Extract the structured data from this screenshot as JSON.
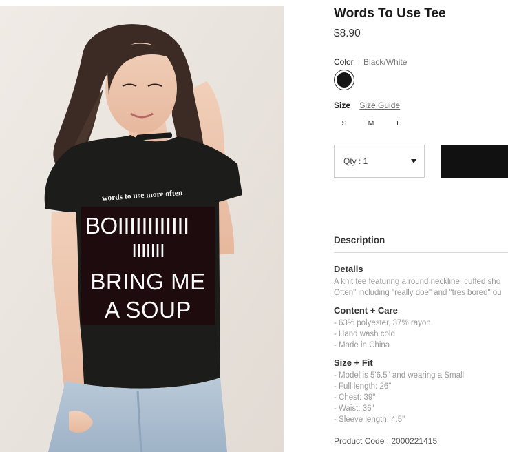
{
  "product": {
    "title": "Words To Use Tee",
    "price": "$8.90",
    "image_alt": "Model wearing black Words To Use Tee",
    "shirt_slogan": "words to use more often",
    "overlay_lines": [
      "BOIIIIIIIIIIII",
      "IIIIIII",
      "BRING ME",
      "A SOUP"
    ]
  },
  "color": {
    "label": "Color",
    "separator": ":",
    "value": "Black/White",
    "swatch_hex": "#161616"
  },
  "size": {
    "label": "Size",
    "guide_link": "Size Guide",
    "options": [
      "S",
      "M",
      "L"
    ]
  },
  "qty": {
    "label": "Qty : 1"
  },
  "description": {
    "heading": "Description",
    "details": {
      "heading": "Details",
      "lines": [
        "A knit tee featuring a round neckline, cuffed sho",
        "Often\" including \"really doe\" and \"tres bored\" ou"
      ]
    },
    "content_care": {
      "heading": "Content + Care",
      "lines": [
        "- 63% polyester, 37% rayon",
        "- Hand wash cold",
        "- Made in China"
      ]
    },
    "size_fit": {
      "heading": "Size + Fit",
      "lines": [
        "- Model is 5'6.5\" and wearing a Small",
        "- Full length: 26\"",
        "- Chest: 39\"",
        "- Waist: 36\"",
        "- Sleeve length: 4.5\""
      ]
    },
    "product_code": "Product Code : 2000221415"
  }
}
